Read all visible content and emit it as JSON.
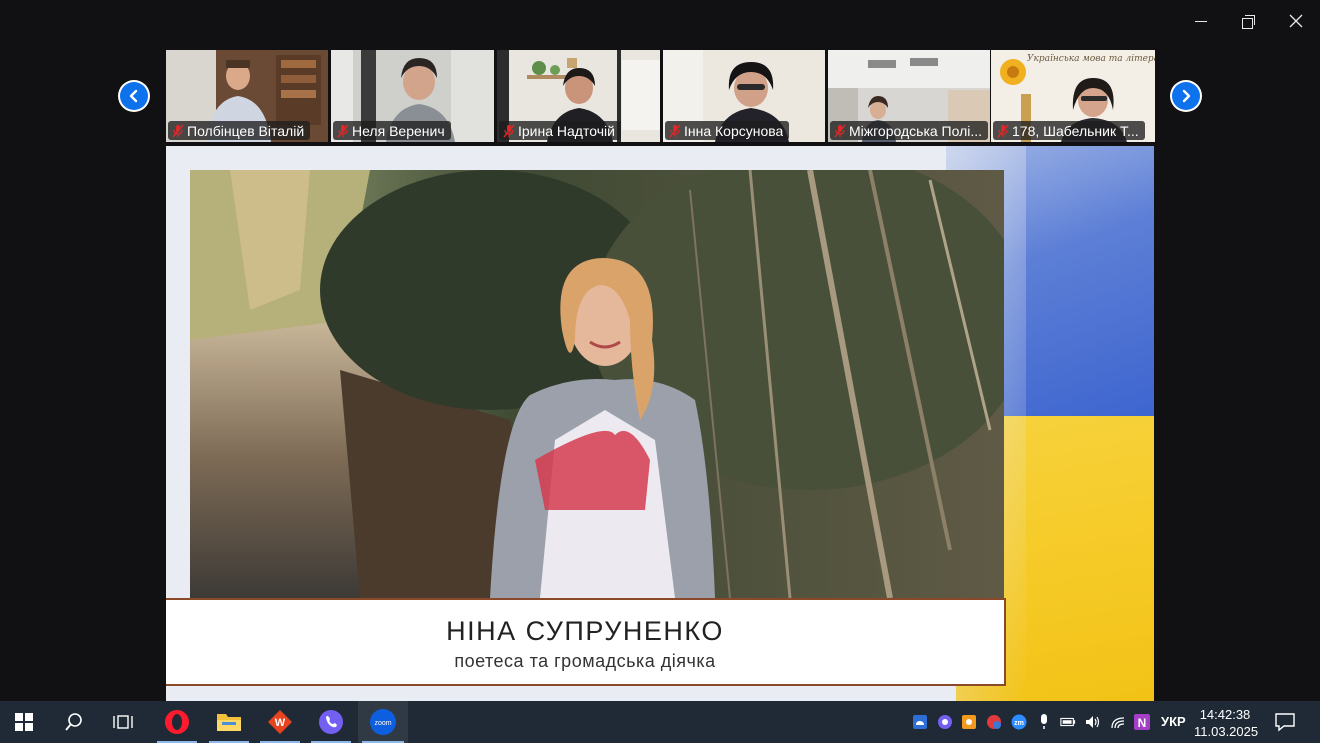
{
  "window": {
    "controls": [
      "minimize",
      "maximize",
      "close"
    ]
  },
  "gallery": {
    "participants": [
      {
        "name": "Полбінцев Віталій",
        "muted": true
      },
      {
        "name": "Неля Веренич",
        "muted": true
      },
      {
        "name": "Ірина Надточій",
        "muted": true
      },
      {
        "name": "Інна Корсунова",
        "muted": true
      },
      {
        "name": "Міжгородська Полі...",
        "muted": true
      },
      {
        "name": "178, Шабельник Т...",
        "muted": true
      }
    ],
    "tile6_banner": "Українська мова та література"
  },
  "share": {
    "person_name": "НІНА СУПРУНЕНКО",
    "person_role": "поетеса та громадська діячка"
  },
  "taskbar": {
    "apps": [
      "start",
      "search",
      "task-view",
      "opera",
      "file-explorer",
      "wps-office",
      "viber",
      "zoom"
    ],
    "active_app": "zoom",
    "language": "УКР",
    "time": "14:42:38",
    "date": "11.03.2025",
    "zoom_label": "zoom",
    "zm_label": "zm",
    "onenote_label": "N"
  },
  "colors": {
    "zoom_blue": "#0e72ed",
    "flag_blue": "#3c64cf",
    "flag_yellow": "#f5c924",
    "taskbar": "#1f2a36"
  }
}
